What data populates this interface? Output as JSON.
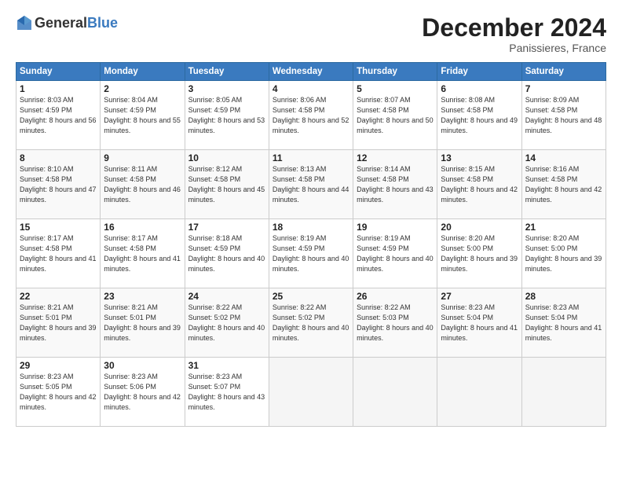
{
  "header": {
    "logo_general": "General",
    "logo_blue": "Blue",
    "month_title": "December 2024",
    "subtitle": "Panissieres, France"
  },
  "weekdays": [
    "Sunday",
    "Monday",
    "Tuesday",
    "Wednesday",
    "Thursday",
    "Friday",
    "Saturday"
  ],
  "weeks": [
    [
      {
        "day": "1",
        "sunrise": "8:03 AM",
        "sunset": "4:59 PM",
        "daylight": "8 hours and 56 minutes."
      },
      {
        "day": "2",
        "sunrise": "8:04 AM",
        "sunset": "4:59 PM",
        "daylight": "8 hours and 55 minutes."
      },
      {
        "day": "3",
        "sunrise": "8:05 AM",
        "sunset": "4:59 PM",
        "daylight": "8 hours and 53 minutes."
      },
      {
        "day": "4",
        "sunrise": "8:06 AM",
        "sunset": "4:58 PM",
        "daylight": "8 hours and 52 minutes."
      },
      {
        "day": "5",
        "sunrise": "8:07 AM",
        "sunset": "4:58 PM",
        "daylight": "8 hours and 50 minutes."
      },
      {
        "day": "6",
        "sunrise": "8:08 AM",
        "sunset": "4:58 PM",
        "daylight": "8 hours and 49 minutes."
      },
      {
        "day": "7",
        "sunrise": "8:09 AM",
        "sunset": "4:58 PM",
        "daylight": "8 hours and 48 minutes."
      }
    ],
    [
      {
        "day": "8",
        "sunrise": "8:10 AM",
        "sunset": "4:58 PM",
        "daylight": "8 hours and 47 minutes."
      },
      {
        "day": "9",
        "sunrise": "8:11 AM",
        "sunset": "4:58 PM",
        "daylight": "8 hours and 46 minutes."
      },
      {
        "day": "10",
        "sunrise": "8:12 AM",
        "sunset": "4:58 PM",
        "daylight": "8 hours and 45 minutes."
      },
      {
        "day": "11",
        "sunrise": "8:13 AM",
        "sunset": "4:58 PM",
        "daylight": "8 hours and 44 minutes."
      },
      {
        "day": "12",
        "sunrise": "8:14 AM",
        "sunset": "4:58 PM",
        "daylight": "8 hours and 43 minutes."
      },
      {
        "day": "13",
        "sunrise": "8:15 AM",
        "sunset": "4:58 PM",
        "daylight": "8 hours and 42 minutes."
      },
      {
        "day": "14",
        "sunrise": "8:16 AM",
        "sunset": "4:58 PM",
        "daylight": "8 hours and 42 minutes."
      }
    ],
    [
      {
        "day": "15",
        "sunrise": "8:17 AM",
        "sunset": "4:58 PM",
        "daylight": "8 hours and 41 minutes."
      },
      {
        "day": "16",
        "sunrise": "8:17 AM",
        "sunset": "4:58 PM",
        "daylight": "8 hours and 41 minutes."
      },
      {
        "day": "17",
        "sunrise": "8:18 AM",
        "sunset": "4:59 PM",
        "daylight": "8 hours and 40 minutes."
      },
      {
        "day": "18",
        "sunrise": "8:19 AM",
        "sunset": "4:59 PM",
        "daylight": "8 hours and 40 minutes."
      },
      {
        "day": "19",
        "sunrise": "8:19 AM",
        "sunset": "4:59 PM",
        "daylight": "8 hours and 40 minutes."
      },
      {
        "day": "20",
        "sunrise": "8:20 AM",
        "sunset": "5:00 PM",
        "daylight": "8 hours and 39 minutes."
      },
      {
        "day": "21",
        "sunrise": "8:20 AM",
        "sunset": "5:00 PM",
        "daylight": "8 hours and 39 minutes."
      }
    ],
    [
      {
        "day": "22",
        "sunrise": "8:21 AM",
        "sunset": "5:01 PM",
        "daylight": "8 hours and 39 minutes."
      },
      {
        "day": "23",
        "sunrise": "8:21 AM",
        "sunset": "5:01 PM",
        "daylight": "8 hours and 39 minutes."
      },
      {
        "day": "24",
        "sunrise": "8:22 AM",
        "sunset": "5:02 PM",
        "daylight": "8 hours and 40 minutes."
      },
      {
        "day": "25",
        "sunrise": "8:22 AM",
        "sunset": "5:02 PM",
        "daylight": "8 hours and 40 minutes."
      },
      {
        "day": "26",
        "sunrise": "8:22 AM",
        "sunset": "5:03 PM",
        "daylight": "8 hours and 40 minutes."
      },
      {
        "day": "27",
        "sunrise": "8:23 AM",
        "sunset": "5:04 PM",
        "daylight": "8 hours and 41 minutes."
      },
      {
        "day": "28",
        "sunrise": "8:23 AM",
        "sunset": "5:04 PM",
        "daylight": "8 hours and 41 minutes."
      }
    ],
    [
      {
        "day": "29",
        "sunrise": "8:23 AM",
        "sunset": "5:05 PM",
        "daylight": "8 hours and 42 minutes."
      },
      {
        "day": "30",
        "sunrise": "8:23 AM",
        "sunset": "5:06 PM",
        "daylight": "8 hours and 42 minutes."
      },
      {
        "day": "31",
        "sunrise": "8:23 AM",
        "sunset": "5:07 PM",
        "daylight": "8 hours and 43 minutes."
      },
      null,
      null,
      null,
      null
    ]
  ],
  "labels": {
    "sunrise": "Sunrise: ",
    "sunset": "Sunset: ",
    "daylight": "Daylight: "
  }
}
